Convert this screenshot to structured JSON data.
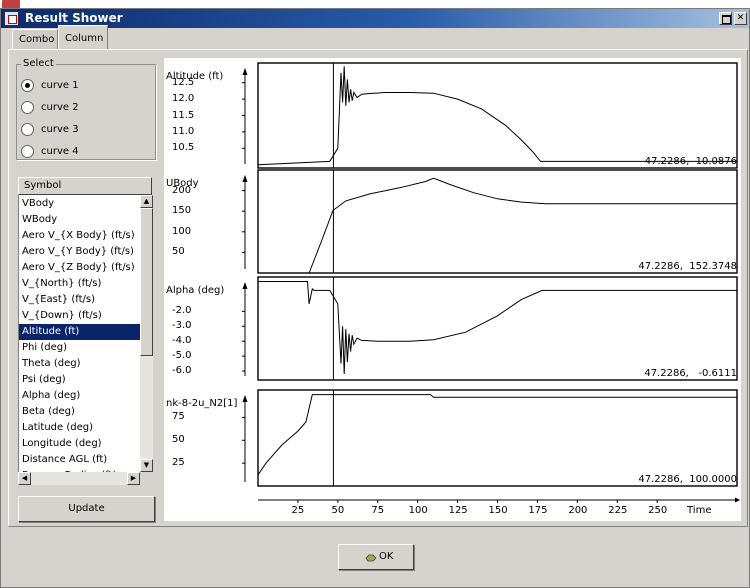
{
  "window": {
    "title": "Result Shower"
  },
  "tabs": [
    {
      "label": "Combo"
    },
    {
      "label": "Column"
    }
  ],
  "select": {
    "title": "Select",
    "options": [
      {
        "label": "curve 1",
        "checked": true
      },
      {
        "label": "curve 2",
        "checked": false
      },
      {
        "label": "curve 3",
        "checked": false
      },
      {
        "label": "curve 4",
        "checked": false
      }
    ]
  },
  "symbol_list": {
    "header": "Symbol",
    "items": [
      "VBody",
      "WBody",
      "Aero V_{X Body} (ft/s)",
      "Aero V_{Y Body} (ft/s)",
      "Aero V_{Z Body} (ft/s)",
      "V_{North} (ft/s)",
      "V_{East} (ft/s)",
      "V_{Down} (ft/s)",
      "Altitude (ft)",
      "Phi (deg)",
      "Theta (deg)",
      "Psi (deg)",
      "Alpha (deg)",
      "Beta (deg)",
      "Latitude (deg)",
      "Longitude (deg)",
      "Distance AGL (ft)",
      "Runway Radius (ft)"
    ],
    "selected_index": 8
  },
  "buttons": {
    "update": "Update",
    "ok": "OK"
  },
  "chart_data": {
    "type": "line",
    "x_axis": {
      "label": "Time",
      "ticks": [
        25,
        50,
        75,
        100,
        125,
        150,
        175,
        200,
        225,
        250
      ],
      "range": [
        0,
        300
      ]
    },
    "cursor_x": 47.2286,
    "panels": [
      {
        "ylabel": "Altitude (ft)",
        "yticks": [
          "12.5",
          "12.0",
          "11.5",
          "11.0",
          "10.5"
        ],
        "ytick_values": [
          12.5,
          12.0,
          11.5,
          11.0,
          10.5
        ],
        "ylim": [
          9.9,
          13.1
        ],
        "readout": "47.2286,  10.0876",
        "x": [
          0,
          45,
          50,
          52,
          53,
          54,
          55,
          56,
          57,
          58,
          59,
          60,
          62,
          65,
          70,
          80,
          95,
          110,
          125,
          140,
          155,
          165,
          172,
          177,
          300
        ],
        "y": [
          10.0,
          10.1,
          10.5,
          12.8,
          11.9,
          13.0,
          11.8,
          12.6,
          11.9,
          12.3,
          11.95,
          12.2,
          12.05,
          12.15,
          12.17,
          12.2,
          12.2,
          12.18,
          12.0,
          11.7,
          11.2,
          10.75,
          10.4,
          10.1,
          10.1
        ]
      },
      {
        "ylabel": "UBody",
        "yticks": [
          "200",
          "150",
          "100",
          "50"
        ],
        "ytick_values": [
          200,
          150,
          100,
          50
        ],
        "ylim": [
          0,
          250
        ],
        "readout": "47.2286,  152.3748",
        "x": [
          0,
          32,
          40,
          47,
          55,
          70,
          90,
          105,
          110,
          120,
          135,
          150,
          165,
          180,
          300
        ],
        "y": [
          0,
          0,
          80,
          152,
          175,
          192,
          208,
          222,
          230,
          215,
          195,
          180,
          172,
          168,
          168
        ]
      },
      {
        "ylabel": "Alpha (deg)",
        "yticks": [
          "-2.0",
          "-3.0",
          "-4.0",
          "-5.0",
          "-6.0"
        ],
        "ytick_values": [
          -2,
          -3,
          -4,
          -5,
          -6
        ],
        "ylim": [
          -6.6,
          0.3
        ],
        "readout": "47.2286,   -0.6111",
        "x": [
          0,
          31,
          32,
          34,
          35,
          45,
          50,
          52,
          53,
          54,
          55,
          56,
          57,
          58,
          59,
          60,
          62,
          65,
          75,
          95,
          110,
          130,
          150,
          165,
          178,
          300
        ],
        "y": [
          0,
          0,
          -1.5,
          -0.5,
          -0.6,
          -0.6,
          -1.5,
          -5.5,
          -3.0,
          -6.2,
          -3.2,
          -5.4,
          -3.5,
          -4.7,
          -3.6,
          -4.2,
          -3.8,
          -3.95,
          -4.0,
          -4.0,
          -3.9,
          -3.4,
          -2.3,
          -1.2,
          -0.6,
          -0.6
        ]
      },
      {
        "ylabel": "nk-8-2u_N2[1]",
        "yticks": [
          "75",
          "50",
          "25"
        ],
        "ytick_values": [
          75,
          50,
          25
        ],
        "ylim": [
          0,
          105
        ],
        "readout": "47.2286,  100.0000",
        "x": [
          0,
          5,
          15,
          25,
          30,
          34,
          108,
          110,
          300
        ],
        "y": [
          12,
          25,
          45,
          60,
          70,
          100,
          100,
          97,
          97
        ]
      }
    ]
  }
}
